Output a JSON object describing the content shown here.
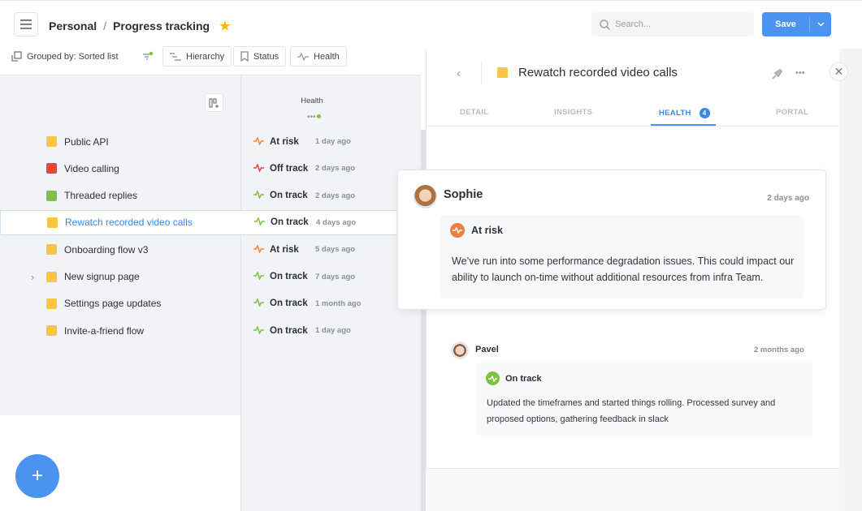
{
  "header": {
    "breadcrumb": [
      "Personal",
      "Progress tracking"
    ],
    "separator": "/",
    "search_placeholder": "Search...",
    "save_label": "Save"
  },
  "toolbar": {
    "grouped_by": "Grouped by: Sorted list",
    "hierarchy": "Hierarchy",
    "status": "Status",
    "health": "Health"
  },
  "health_column_header": "Health",
  "colors": {
    "accent": "#4b93f1",
    "yellow": "#f7c744",
    "red": "#e8443a",
    "green": "#7dc242",
    "orange": "#f08a3c"
  },
  "rows": [
    {
      "name": "Public API",
      "color": "#f7c744",
      "health": "At risk",
      "health_color": "#f08a3c",
      "time": "1 day ago"
    },
    {
      "name": "Video calling",
      "color": "#e8443a",
      "health": "Off track",
      "health_color": "#e8443a",
      "time": "2 days ago"
    },
    {
      "name": "Threaded replies",
      "color": "#7dc242",
      "health": "On track",
      "health_color": "#7dc242",
      "time": "2 days ago"
    },
    {
      "name": "Rewatch recorded video calls",
      "color": "#f7c744",
      "health": "On track",
      "health_color": "#7dc242",
      "time": "4 days ago",
      "selected": true
    },
    {
      "name": "Onboarding flow v3",
      "color": "#f7c744",
      "health": "At risk",
      "health_color": "#f08a3c",
      "time": "5 days ago"
    },
    {
      "name": "New signup page",
      "color": "#f7c744",
      "health": "On track",
      "health_color": "#7dc242",
      "time": "7 days ago",
      "expandable": true
    },
    {
      "name": "Settings page updates",
      "color": "#f7c744",
      "health": "On track",
      "health_color": "#7dc242",
      "time": "1 month ago"
    },
    {
      "name": "Invite-a-friend flow",
      "color": "#f7c744",
      "health": "On track",
      "health_color": "#7dc242",
      "time": "1 day ago"
    }
  ],
  "detail": {
    "title": "Rewatch recorded video calls",
    "tabs": [
      "DETAIL",
      "INSIGHTS",
      "HEALTH",
      "PORTAL"
    ],
    "active_tab": "HEALTH",
    "health_count": "4",
    "updates": [
      {
        "author": "Sophie",
        "time": "2 days ago",
        "status": "At risk",
        "status_color": "#e8803f",
        "text": "We’ve run into some performance degradation issues. This could impact our ability to launch on-time without additional resources from infra Team."
      },
      {
        "author": "Pavel",
        "time": "2 months ago",
        "status": "On track",
        "status_color": "#7dc242",
        "text": "Updated the timeframes and started things rolling. Processed survey and proposed options, gathering feedback in slack"
      }
    ]
  },
  "fab_label": "+"
}
